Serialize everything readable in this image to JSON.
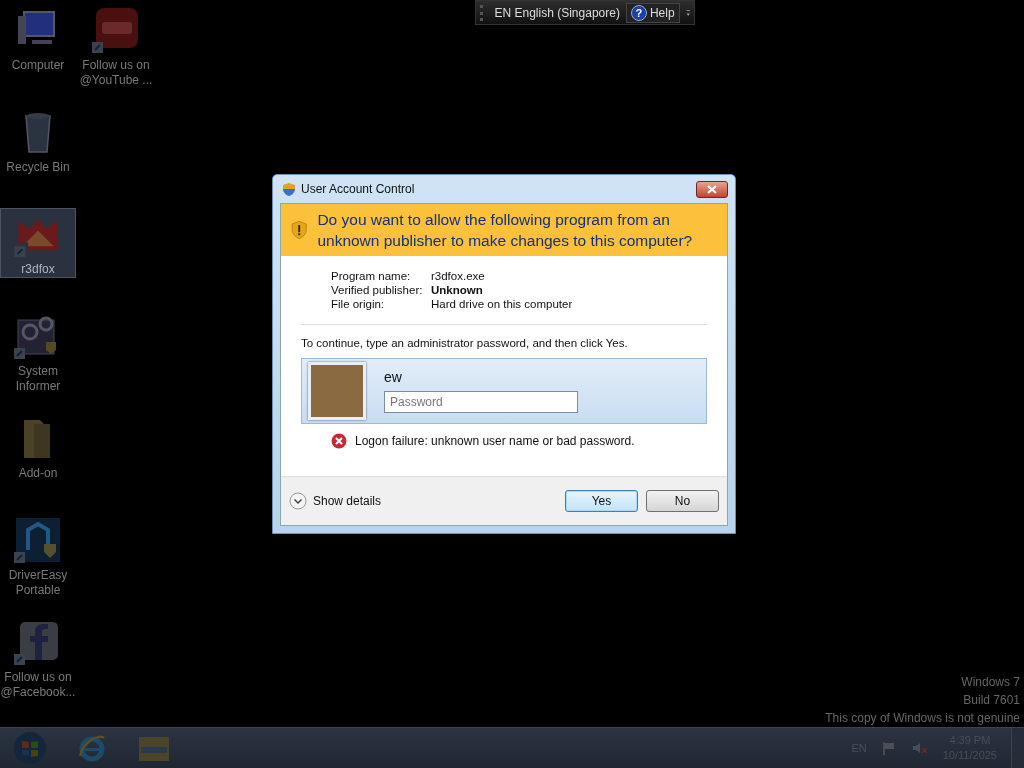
{
  "language_bar": {
    "language": "EN English (Singapore)",
    "help_icon": "?",
    "help": "Help"
  },
  "desktop": {
    "columns": [
      {
        "icons": [
          {
            "label": "Computer",
            "kind": "computer",
            "selected": false
          },
          {
            "label": "Recycle Bin",
            "kind": "bin",
            "selected": false
          },
          {
            "label": "r3dfox",
            "kind": "browser",
            "selected": true
          },
          {
            "label": "System Informer",
            "kind": "gears",
            "selected": false
          },
          {
            "label": "Add-on",
            "kind": "folder",
            "selected": false
          },
          {
            "label": "DriverEasy Portable",
            "kind": "drivereasy",
            "selected": false
          },
          {
            "label": "Follow us on @Facebook...",
            "kind": "facebook",
            "selected": false
          }
        ]
      },
      {
        "icons": [
          {
            "label": "Follow us on @YouTube ...",
            "kind": "youtube",
            "selected": false
          }
        ]
      }
    ]
  },
  "dialog": {
    "title": "User Account Control",
    "question": "Do you want to allow the following program from an unknown publisher to make changes to this computer?",
    "details": [
      {
        "label": "Program name:",
        "value": "r3dfox.exe",
        "bold": false
      },
      {
        "label": "Verified publisher:",
        "value": "Unknown",
        "bold": true
      },
      {
        "label": "File origin:",
        "value": "Hard drive on this computer",
        "bold": false
      }
    ],
    "instruction": "To continue, type an administrator password, and then click Yes.",
    "account": {
      "user_name": "ew",
      "password": {
        "placeholder": "Password"
      }
    },
    "error": "Logon failure: unknown user name or bad password.",
    "show_details": "Show details",
    "buttons": [
      {
        "label": "Yes",
        "default": true
      },
      {
        "label": "No",
        "default": false
      }
    ]
  },
  "watermark": [
    "Windows 7",
    "Build 7601",
    "This copy of Windows is not genuine"
  ],
  "taskbar": {
    "pinned": [
      {
        "kind": "start"
      },
      {
        "kind": "ie"
      },
      {
        "kind": "explorer"
      }
    ],
    "language": "EN",
    "time": "4:39 PM",
    "date": "10/11/2025"
  }
}
